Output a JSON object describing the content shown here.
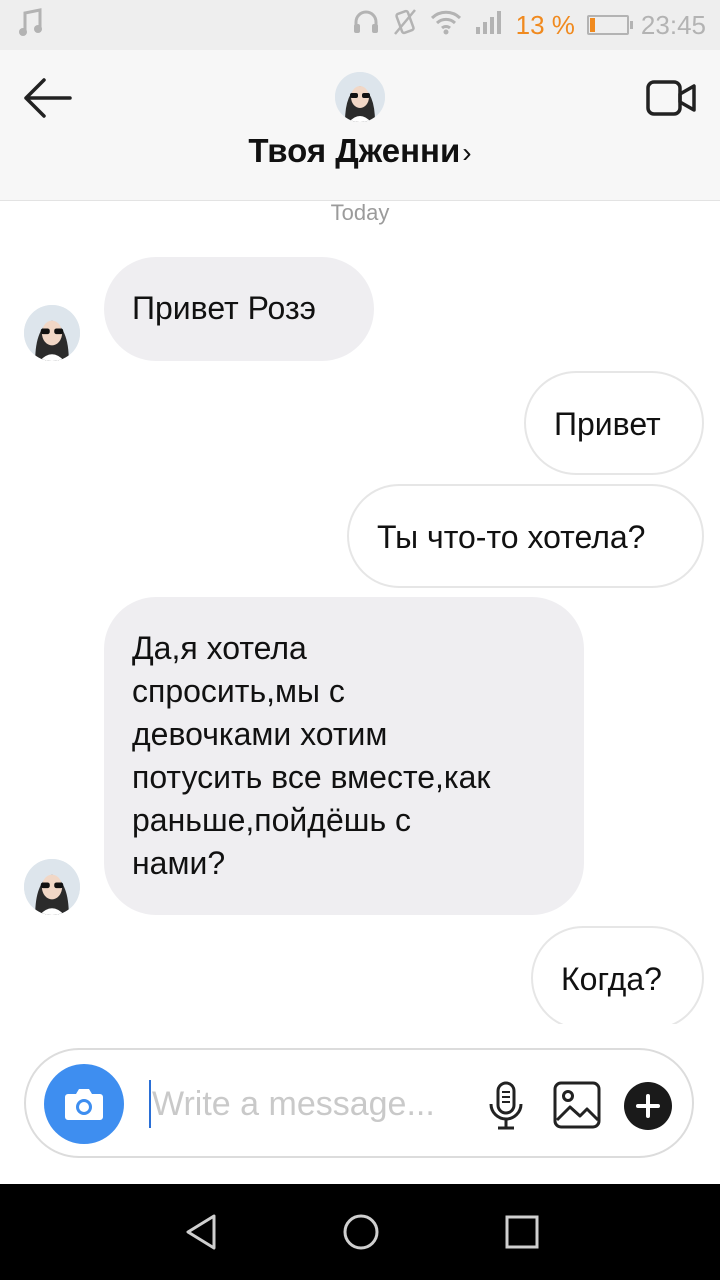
{
  "status_bar": {
    "battery_percent": "13 %",
    "battery_level": 0.13,
    "time": "23:45",
    "icons": [
      "music-note-icon",
      "headphones-icon",
      "vibrate-off-icon",
      "wifi-icon",
      "signal-icon",
      "battery-icon"
    ]
  },
  "header": {
    "title": "Твоя Дженни",
    "title_chevron": "›",
    "back_icon": "arrow-left-icon",
    "video_icon": "video-camera-icon"
  },
  "thread": {
    "date_separator": "Today",
    "messages": [
      {
        "direction": "in",
        "lines": [
          "Привет Розэ"
        ]
      },
      {
        "direction": "out",
        "lines": [
          "Привет"
        ]
      },
      {
        "direction": "out",
        "lines": [
          "Ты что-то хотела?"
        ]
      },
      {
        "direction": "in",
        "lines": [
          "Да,я хотела",
          "спросить,мы с",
          "девочками хотим",
          "потусить все вместе,как",
          "раньше,пойдёшь с",
          "нами?"
        ]
      },
      {
        "direction": "out",
        "lines": [
          "Когда?"
        ]
      }
    ]
  },
  "composer": {
    "placeholder": "Write a message...",
    "value": "",
    "icons": [
      "camera-icon",
      "microphone-icon",
      "image-icon",
      "plus-icon"
    ]
  },
  "nav_bar": {
    "icons": [
      "back-triangle-icon",
      "home-circle-icon",
      "recents-square-icon"
    ]
  },
  "colors": {
    "accent_blue": "#3e8ef0",
    "battery_orange": "#f08a1f",
    "incoming_bubble": "#efeef1",
    "outgoing_border": "#e6e6e6"
  }
}
